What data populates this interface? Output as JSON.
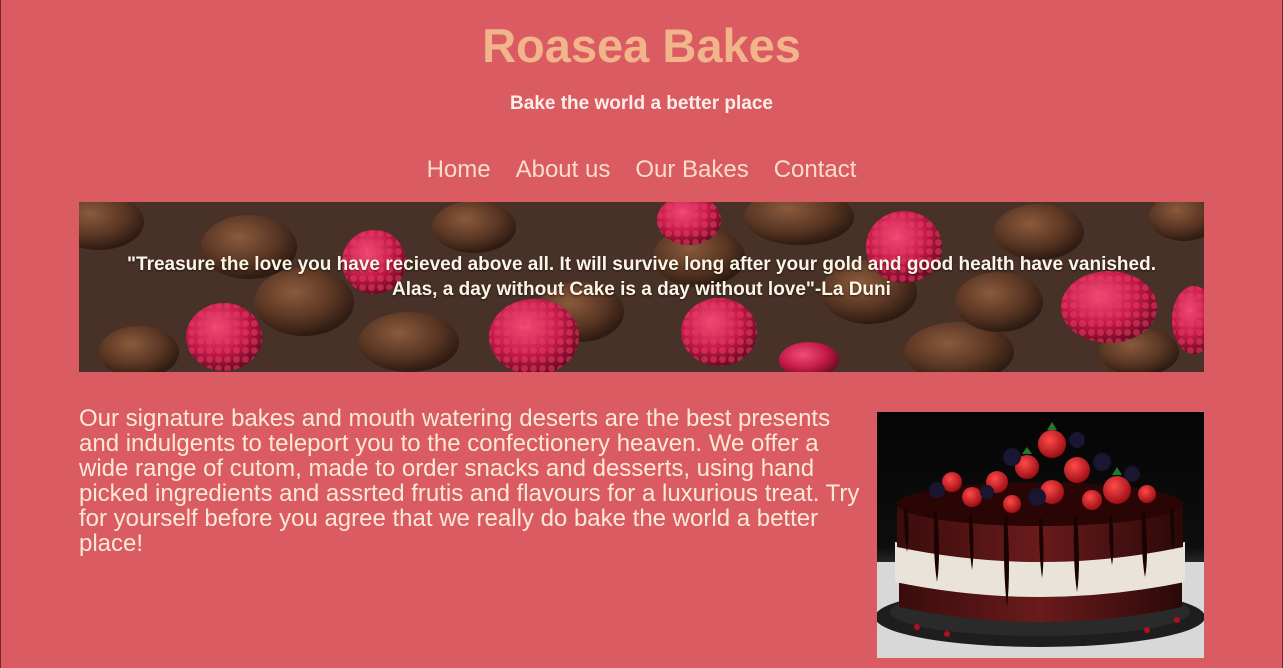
{
  "site": {
    "title": "Roasea Bakes",
    "tagline": "Bake the world a better place"
  },
  "nav": {
    "items": [
      "Home",
      "About us",
      "Our Bakes",
      "Contact"
    ]
  },
  "banner": {
    "quote_line1": "\"Treasure the love you have recieved above all. It will survive long after your gold and good health have vanished.",
    "quote_line2": "Alas, a day without Cake is a day without love\"-La Duni"
  },
  "main": {
    "intro": "Our signature bakes and mouth watering deserts are the best presents and indulgents to teleport you to the confectionery heaven. We offer a wide range of cutom, made to order snacks and desserts, using hand picked ingredients and assrted frutis and flavours for a luxurious treat. Try for yourself before you agree that we really do bake the world a better place!"
  },
  "colors": {
    "background": "#db5b63",
    "title": "#f2b48a",
    "nav_link": "#f9ddc8",
    "body_text": "#fbe9d8"
  }
}
